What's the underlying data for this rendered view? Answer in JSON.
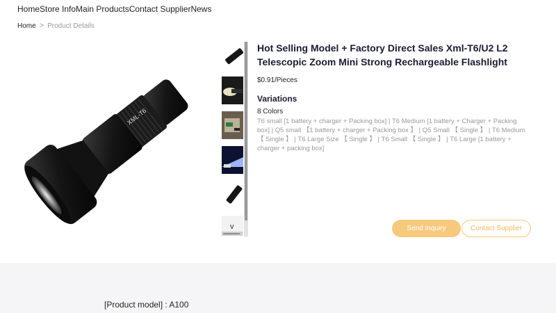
{
  "nav": {
    "items": [
      "Home",
      "Store Info",
      "Main Products",
      "Contact Supplier",
      "News"
    ]
  },
  "breadcrumb": {
    "home": "Home",
    "separator": ">",
    "current": "Product Details"
  },
  "product": {
    "title": "Hot Selling Model + Factory Direct Sales Xml-T6/U2 L2 Telescopic Zoom Mini Strong Rechargeable Flashlight",
    "price": "$0.91/Pieces",
    "variations_heading": "Variations",
    "variations_count": "8 Colors",
    "variations_list": "T6 small [1 battery + charger + Packing box] | T6 Medium [1 battery + Charger + Packing box] | Q5 small 【1 battery + charger + Packing box 】 | Q5 Small 【 Single 】 | T6 Medium 【 Single 】 | T6 Large Size 【 Single 】 | T6 Small 【 Single 】 | T6 Large [1 battery + charger + packing box]",
    "image_label": "XML-T6"
  },
  "thumbnails": {
    "chevron": "v"
  },
  "actions": {
    "send_inquiry": "Send Inquiry",
    "contact_supplier": "Contact Supplier"
  },
  "details": {
    "model": "[Product model] : A100"
  },
  "colors": {
    "accent": "#f7c97c",
    "accent_text": "#f0b85e",
    "title": "#1b1b33",
    "muted": "#999999",
    "lower_bg": "#f5f5f7"
  }
}
